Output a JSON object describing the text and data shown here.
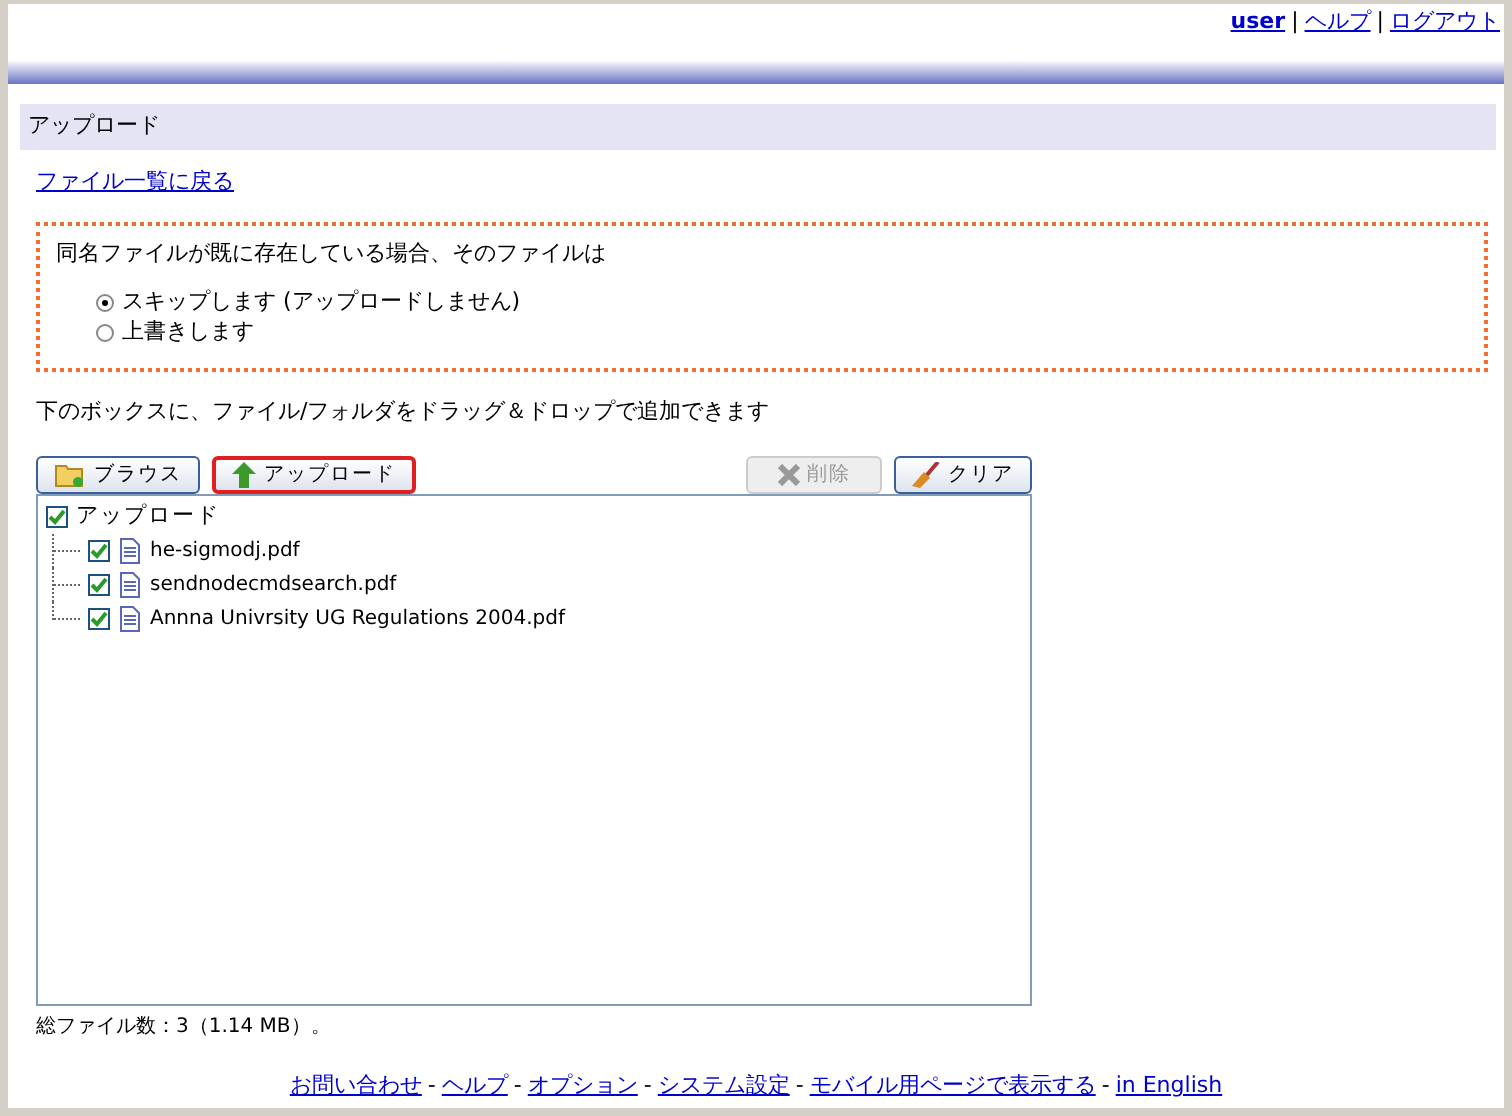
{
  "header_links": [
    {
      "kind": "link",
      "text": "user",
      "bold": true
    },
    {
      "kind": "separator",
      "text": "|"
    },
    {
      "kind": "link",
      "text": "ヘルプ",
      "bold": false
    },
    {
      "kind": "separator",
      "text": "|"
    },
    {
      "kind": "link",
      "text": "ログアウト",
      "bold": false
    }
  ],
  "section_title": "アップロード",
  "back_link": "ファイル一覧に戻る",
  "overwrite_box": {
    "question": "同名ファイルが既に存在している場合、そのファイルは",
    "options": [
      {
        "label": "スキップします (アップロードしません)",
        "selected": true
      },
      {
        "label": "上書きします",
        "selected": false
      }
    ]
  },
  "instruction": "下のボックスに、ファイル/フォルダをドラッグ＆ドロップで追加できます",
  "buttons": [
    {
      "kind": "browse",
      "label": "ブラウス",
      "disabled": false,
      "highlighted": false
    },
    {
      "kind": "upload",
      "label": "アップロード",
      "disabled": false,
      "highlighted": true
    },
    {
      "kind": "delete",
      "label": "削除",
      "disabled": true,
      "highlighted": false
    },
    {
      "kind": "clear",
      "label": "クリア",
      "disabled": false,
      "highlighted": false
    }
  ],
  "tree": {
    "label": "アップロード",
    "checked": true,
    "children": [
      {
        "label": "he-sigmodj.pdf",
        "checked": true
      },
      {
        "label": "sendnodecmdsearch.pdf",
        "checked": true
      },
      {
        "label": "Annna Univrsity UG Regulations 2004.pdf",
        "checked": true
      }
    ]
  },
  "total": "総ファイル数：3（1.14 MB）。",
  "footer_links": [
    {
      "kind": "link",
      "text": "お問い合わせ"
    },
    {
      "kind": "separator",
      "text": "-"
    },
    {
      "kind": "link",
      "text": "ヘルプ"
    },
    {
      "kind": "separator",
      "text": "-"
    },
    {
      "kind": "link",
      "text": "オプション"
    },
    {
      "kind": "separator",
      "text": "-"
    },
    {
      "kind": "link",
      "text": "システム設定"
    },
    {
      "kind": "separator",
      "text": "-"
    },
    {
      "kind": "link",
      "text": "モバイル用ページで表示する"
    },
    {
      "kind": "separator",
      "text": "-"
    },
    {
      "kind": "link",
      "text": "in English"
    }
  ]
}
